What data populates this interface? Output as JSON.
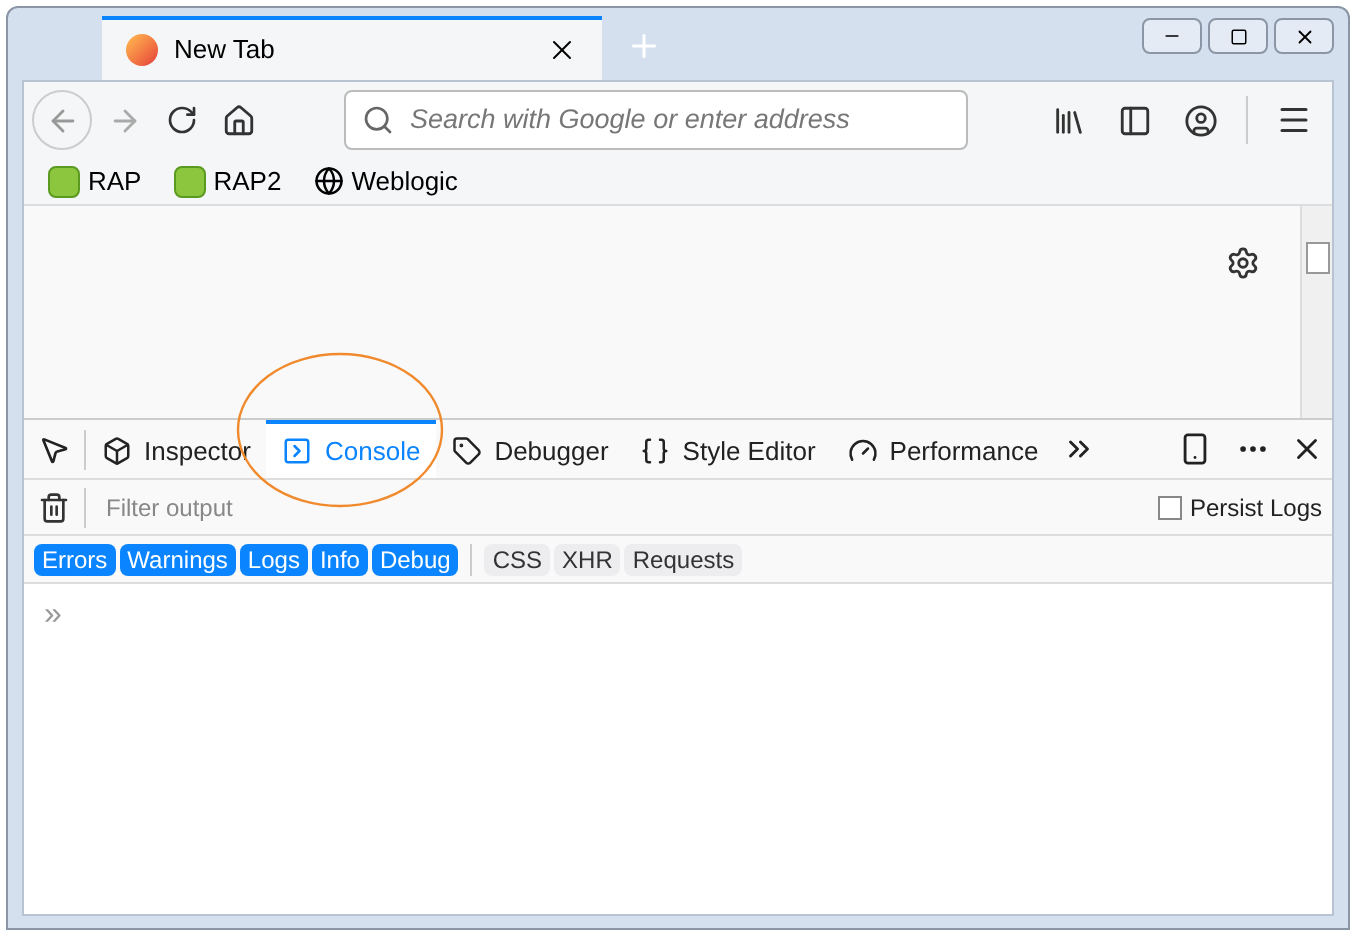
{
  "browser_tab": {
    "title": "New Tab"
  },
  "address_bar": {
    "placeholder": "Search with Google or enter address"
  },
  "bookmarks": [
    {
      "label": "RAP",
      "kind": "rap"
    },
    {
      "label": "RAP2",
      "kind": "rap"
    },
    {
      "label": "Weblogic",
      "kind": "globe"
    }
  ],
  "devtools_tabs": [
    {
      "label": "Inspector",
      "kind": "inspector",
      "selected": false
    },
    {
      "label": "Console",
      "kind": "console",
      "selected": true
    },
    {
      "label": "Debugger",
      "kind": "debugger",
      "selected": false
    },
    {
      "label": "Style Editor",
      "kind": "style",
      "selected": false
    },
    {
      "label": "Performance",
      "kind": "performance",
      "selected": false
    }
  ],
  "filter": {
    "placeholder": "Filter output"
  },
  "persist_logs": {
    "label": "Persist Logs",
    "checked": false
  },
  "filter_buttons": [
    {
      "label": "Errors",
      "selected": true
    },
    {
      "label": "Warnings",
      "selected": true
    },
    {
      "label": "Logs",
      "selected": true
    },
    {
      "label": "Info",
      "selected": true
    },
    {
      "label": "Debug",
      "selected": true
    },
    {
      "label": "CSS",
      "selected": false
    },
    {
      "label": "XHR",
      "selected": false
    },
    {
      "label": "Requests",
      "selected": false
    }
  ],
  "console": {
    "prompt": "»"
  }
}
